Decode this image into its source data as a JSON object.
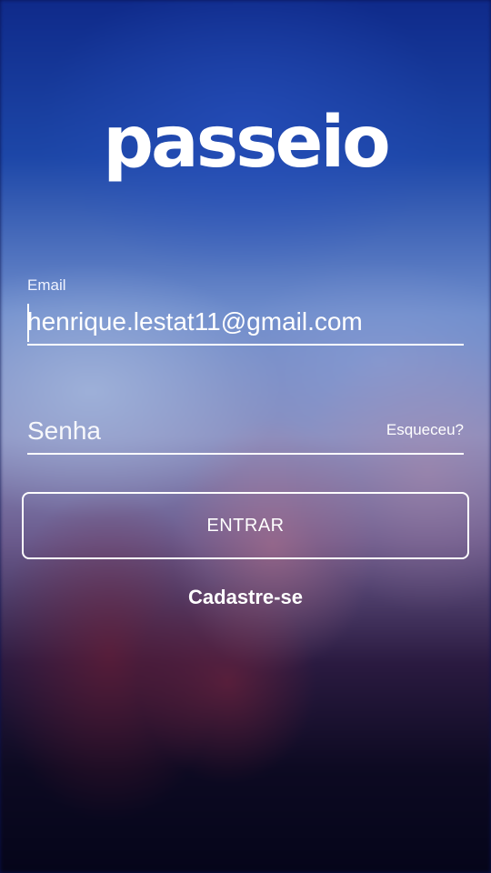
{
  "app": {
    "logo_text": "passeio"
  },
  "login_form": {
    "email": {
      "label": "Email",
      "value": "henrique.lestat11@gmail.com"
    },
    "password": {
      "placeholder": "Senha",
      "forgot_label": "Esqueceu?"
    },
    "submit_label": "ENTRAR",
    "signup_label": "Cadastre-se"
  },
  "colors": {
    "text": "#ffffff",
    "background_top": "#0f2a8a",
    "background_bottom": "#05051a"
  }
}
